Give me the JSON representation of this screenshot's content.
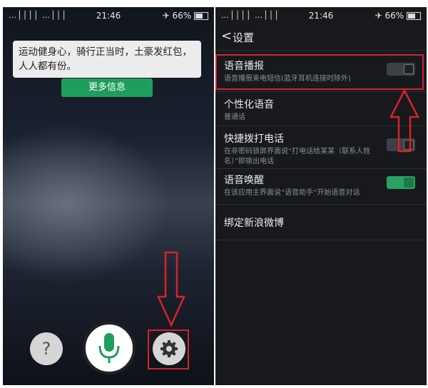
{
  "status": {
    "signal": "…││││ …│││",
    "time": "21:46",
    "battery": "66%"
  },
  "left": {
    "message": "运动健身心，骑行正当时，土豪发红包，人人都有份。",
    "more_button": "更多信息",
    "help_symbol": "?"
  },
  "settings": {
    "title": "设置",
    "back_symbol": "<",
    "items": [
      {
        "title": "语音播报",
        "subtitle": "语音播报来电短信(蓝牙耳机连接时除外)",
        "toggle": "off"
      },
      {
        "title": "个性化语音",
        "subtitle": "普通话"
      },
      {
        "title": "快捷拨打电话",
        "subtitle": "在非密码锁屏界面说“打电话给某某（联系人姓名）”即拨出电话",
        "toggle": "off"
      },
      {
        "title": "语音唤醒",
        "subtitle": "在该应用主界面说“语音助手”开始语音对话",
        "toggle": "on"
      },
      {
        "title": "绑定新浪微博"
      }
    ]
  },
  "colors": {
    "accent": "#1f9d5c",
    "highlight": "#d8232a",
    "panel": "#17191d"
  },
  "icons": [
    "wifi-icon",
    "alarm-icon",
    "battery-icon",
    "microphone-icon",
    "gear-icon",
    "help-icon",
    "back-icon"
  ]
}
